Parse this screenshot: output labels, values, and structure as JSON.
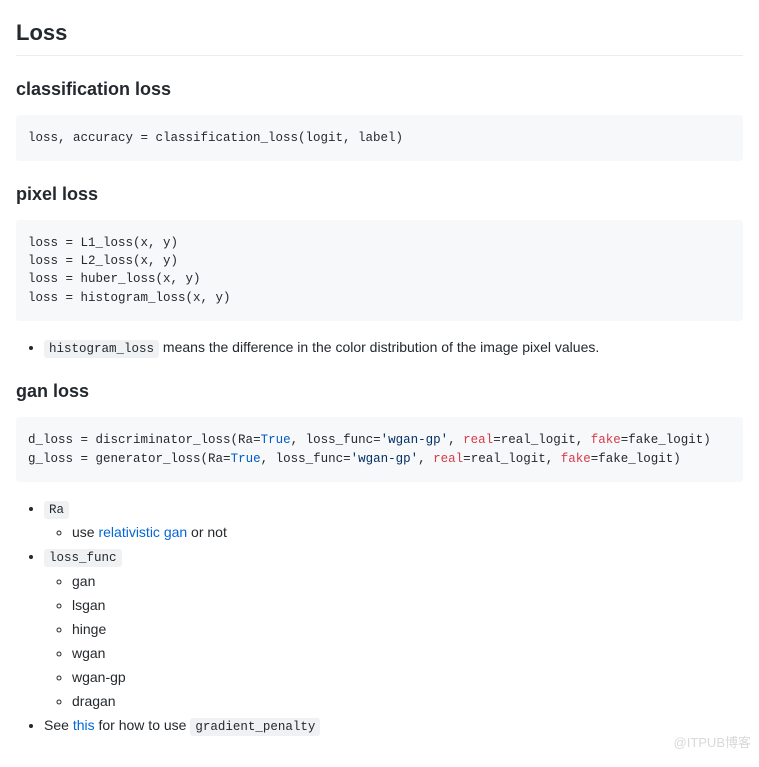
{
  "title": "Loss",
  "sections": {
    "classification": {
      "heading": "classification loss",
      "code": "loss, accuracy = classification_loss(logit, label)"
    },
    "pixel": {
      "heading": "pixel loss",
      "code": "loss = L1_loss(x, y)\nloss = L2_loss(x, y)\nloss = huber_loss(x, y)\nloss = histogram_loss(x, y)",
      "note_code": "histogram_loss",
      "note_text": " means the difference in the color distribution of the image pixel values."
    },
    "gan": {
      "heading": "gan loss",
      "code_line1_prefix": "d_loss = discriminator_loss(",
      "code_line2_prefix": "g_loss = generator_loss(",
      "arg_ra": "Ra",
      "val_true": "True",
      "arg_lossfunc": "loss_func",
      "val_wgangp": "'wgan-gp'",
      "arg_real": "real",
      "val_real": "real_logit",
      "arg_fake": "fake",
      "val_fake": "fake_logit",
      "bullets": {
        "ra_code": "Ra",
        "ra_use_prefix": "use ",
        "ra_link": "relativistic gan",
        "ra_use_suffix": " or not",
        "lossfunc_code": "loss_func",
        "options": {
          "gan": "gan",
          "lsgan": "lsgan",
          "hinge": "hinge",
          "wgan": "wgan",
          "wgan_gp": "wgan-gp",
          "dragan": "dragan"
        },
        "see_prefix": "See ",
        "see_link": "this",
        "see_mid": " for how to use ",
        "see_code": "gradient_penalty"
      }
    }
  },
  "watermark": "@ITPUB博客"
}
